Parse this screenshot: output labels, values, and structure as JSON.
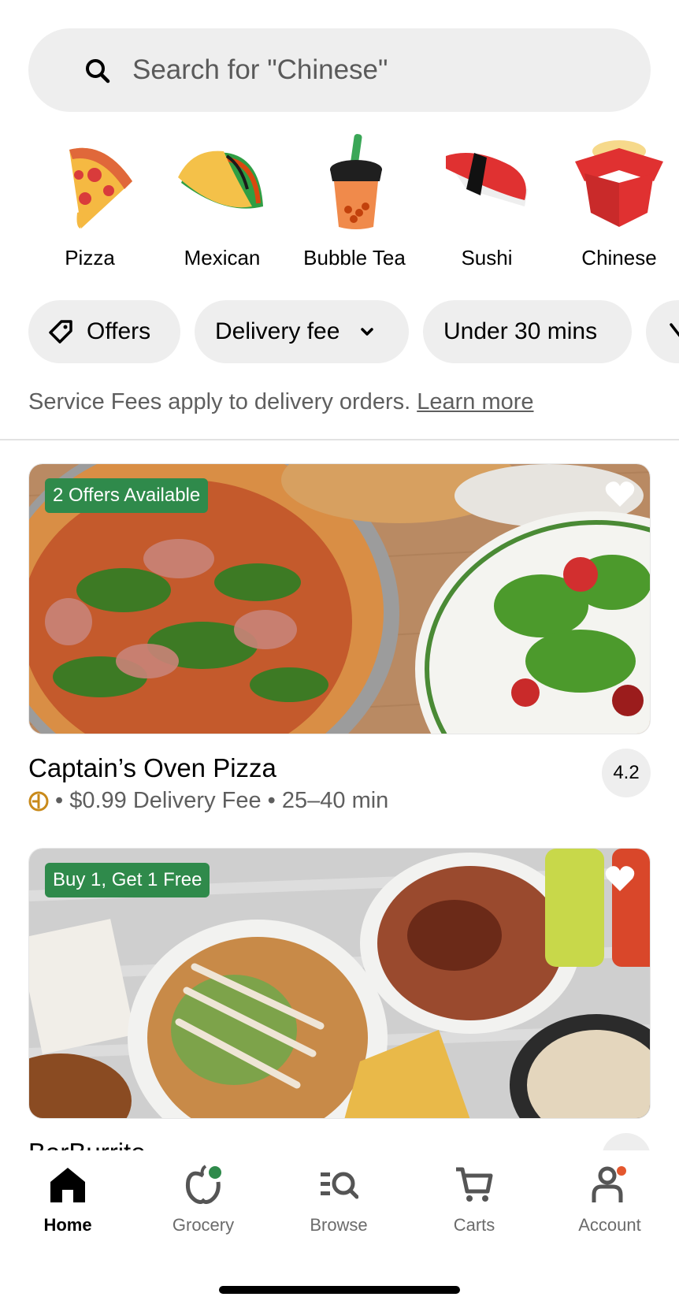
{
  "search": {
    "placeholder": "Search for \"Chinese\""
  },
  "categories": [
    {
      "label": "Pizza",
      "icon": "pizza-icon"
    },
    {
      "label": "Mexican",
      "icon": "taco-icon"
    },
    {
      "label": "Bubble Tea",
      "icon": "bubble-tea-icon"
    },
    {
      "label": "Sushi",
      "icon": "sushi-icon"
    },
    {
      "label": "Chinese",
      "icon": "takeout-box-icon"
    }
  ],
  "filters": {
    "offers": "Offers",
    "delivery_fee": "Delivery fee",
    "under_30": "Under 30 mins"
  },
  "notice": {
    "text": "Service Fees apply to delivery orders.",
    "link": "Learn more"
  },
  "stores": [
    {
      "badge": "2 Offers Available",
      "name": "Captain’s Oven Pizza",
      "meta": "• $0.99 Delivery Fee • 25–40 min",
      "rating": "4.2"
    },
    {
      "badge": "Buy 1, Get 1 Free",
      "name": "BarBurrito"
    }
  ],
  "nav": [
    {
      "label": "Home",
      "active": true
    },
    {
      "label": "Grocery"
    },
    {
      "label": "Browse"
    },
    {
      "label": "Carts"
    },
    {
      "label": "Account"
    }
  ],
  "colors": {
    "promo_green": "#2f8a4b",
    "chip_bg": "#eeeeee",
    "muted_text": "#5e5e5e"
  }
}
